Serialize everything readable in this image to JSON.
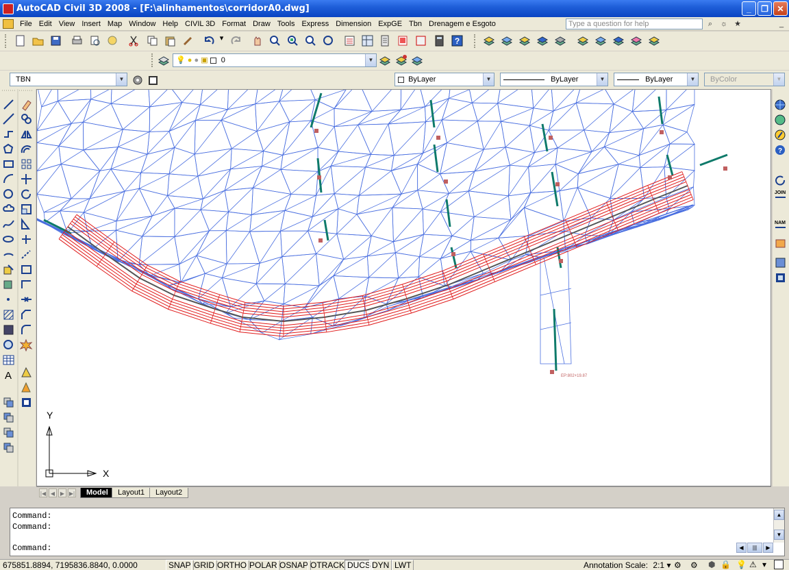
{
  "window": {
    "title": "AutoCAD Civil 3D 2008 - [F:\\alinhamentos\\corridorA0.dwg]",
    "minimize_glyph": "_",
    "restore_glyph": "❐",
    "close_glyph": "✕"
  },
  "menus": [
    "File",
    "Edit",
    "View",
    "Insert",
    "Map",
    "Window",
    "Help",
    "CIVIL 3D",
    "Format",
    "Draw",
    "Tools",
    "Express",
    "Dimension",
    "ExpGE",
    "Tbn",
    "Drenagem e Esgoto"
  ],
  "help": {
    "placeholder": "Type a question for help",
    "doc_min": "_",
    "doc_restore": "❐",
    "doc_close": "✕"
  },
  "layer": {
    "current": "0"
  },
  "properties": {
    "textstyle": "TBN",
    "color": "ByLayer",
    "linetype": "ByLayer",
    "lineweight": "ByLayer",
    "plotstyle": "ByColor"
  },
  "tabs": {
    "model": "Model",
    "layout1": "Layout1",
    "layout2": "Layout2"
  },
  "ucs": {
    "x_label": "X",
    "y_label": "Y"
  },
  "drawing_labels": {
    "end_point": "EP:802+19.87"
  },
  "command": {
    "lines": [
      "Command:",
      "Command:"
    ],
    "prompt": "Command:"
  },
  "status": {
    "coords": "675851.8894, 7195836.8840, 0.0000",
    "toggles": [
      "SNAP",
      "GRID",
      "ORTHO",
      "POLAR",
      "OSNAP",
      "OTRACK",
      "DUCS",
      "DYN",
      "LWT"
    ],
    "active_toggles": [
      "DUCS"
    ],
    "annotation_scale_label": "Annotation Scale:",
    "annotation_scale": "2:1"
  },
  "colors": {
    "titlebar": "#0a44c2",
    "tin_lines": "#4a6fe0",
    "corridor": "#e01818",
    "sample_lines": "#0e7a6a",
    "labels": "#c06060"
  }
}
